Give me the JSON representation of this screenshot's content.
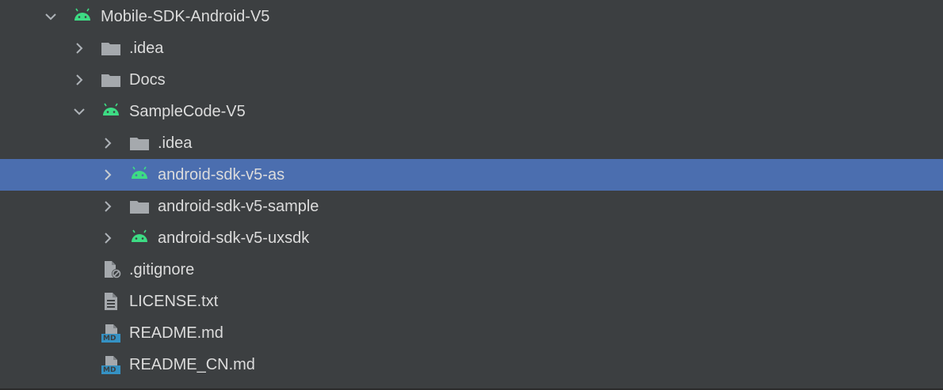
{
  "colors": {
    "background": "#3c3f41",
    "selection": "#4b6eaf",
    "text": "#dcdcdc",
    "folder": "#a5a9ad",
    "android": "#3ddc84",
    "markdown_badge": "#3592c4"
  },
  "tree": {
    "items": [
      {
        "label": "Mobile-SDK-Android-V5",
        "icon": "android-module-icon",
        "expanded": true,
        "depth": 0
      },
      {
        "label": ".idea",
        "icon": "folder-icon",
        "expanded": false,
        "depth": 1
      },
      {
        "label": "Docs",
        "icon": "folder-icon",
        "expanded": false,
        "depth": 1
      },
      {
        "label": "SampleCode-V5",
        "icon": "android-module-icon",
        "expanded": true,
        "depth": 1
      },
      {
        "label": ".idea",
        "icon": "folder-icon",
        "expanded": false,
        "depth": 2
      },
      {
        "label": "android-sdk-v5-as",
        "icon": "android-module-icon",
        "expanded": false,
        "depth": 2,
        "selected": true
      },
      {
        "label": "android-sdk-v5-sample",
        "icon": "folder-icon",
        "expanded": false,
        "depth": 2
      },
      {
        "label": "android-sdk-v5-uxsdk",
        "icon": "android-module-icon",
        "expanded": false,
        "depth": 2
      },
      {
        "label": ".gitignore",
        "icon": "ignore-file-icon",
        "depth": 1
      },
      {
        "label": "LICENSE.txt",
        "icon": "text-file-icon",
        "depth": 1
      },
      {
        "label": "README.md",
        "icon": "markdown-file-icon",
        "badge": "MD",
        "depth": 1
      },
      {
        "label": "README_CN.md",
        "icon": "markdown-file-icon",
        "badge": "MD",
        "depth": 1
      }
    ]
  }
}
